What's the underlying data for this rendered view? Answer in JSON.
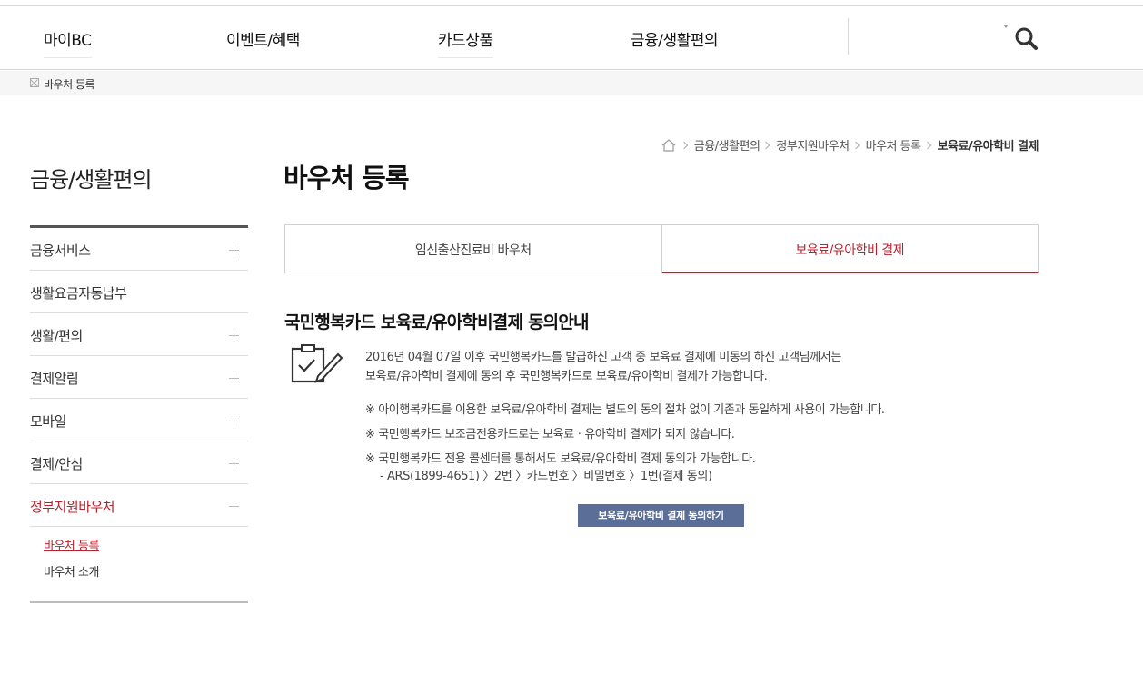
{
  "gnb": {
    "items": [
      "마이BC",
      "이벤트/혜택",
      "카드상품",
      "금융/생활편의"
    ]
  },
  "subbar": {
    "label": "바우처 등록"
  },
  "breadcrumb": {
    "items": [
      "금융/생활편의",
      "정부지원바우처",
      "바우처 등록"
    ],
    "current": "보육료/유아학비 결제"
  },
  "lnb": {
    "title": "금융/생활편의",
    "items": [
      "금융서비스",
      "생활요금자동납부",
      "생활/편의",
      "결제알림",
      "모바일",
      "결제/안심",
      "정부지원바우처"
    ],
    "sub_items": [
      "바우처 등록",
      "바우처 소개"
    ]
  },
  "main": {
    "title": "바우처 등록",
    "tabs": [
      "임신출산진료비 바우처",
      "보육료/유아학비 결제"
    ],
    "section_title": "국민행복카드 보육료/유아학비결제 동의안내",
    "desc_lines": [
      "2016년 04월 07일 이후 국민행복카드를 발급하신 고객 중 보육료 결제에 미동의 하신 고객님께서는",
      "보육료/유아학비 결제에 동의 후 국민행복카드로 보육료/유아학비 결제가 가능합니다."
    ],
    "notes": [
      "※ 아이행복카드를 이용한 보육료/유아학비 결제는 별도의 동의 절차 없이 기존과 동일하게 사용이 가능합니다.",
      "※ 국민행복카드 보조금전용카드로는 보육료ㆍ유아학비 결제가 되지 않습니다.",
      "※ 국민행복카드 전용 콜센터를 통해서도 보육료/유아학비 결제 동의가 가능합니다."
    ],
    "note_sub": "- ARS(1899-4651) 〉2번 〉카드번호 〉비밀번호 〉1번(결제 동의)",
    "agree_button": "보육료/유아학비 결제 동의하기"
  },
  "colors": {
    "accent": "#b7222d",
    "button": "#5a6e97"
  },
  "icons": [
    "home-icon",
    "search-icon",
    "clipboard-check-icon",
    "plus-icon",
    "minus-icon"
  ]
}
